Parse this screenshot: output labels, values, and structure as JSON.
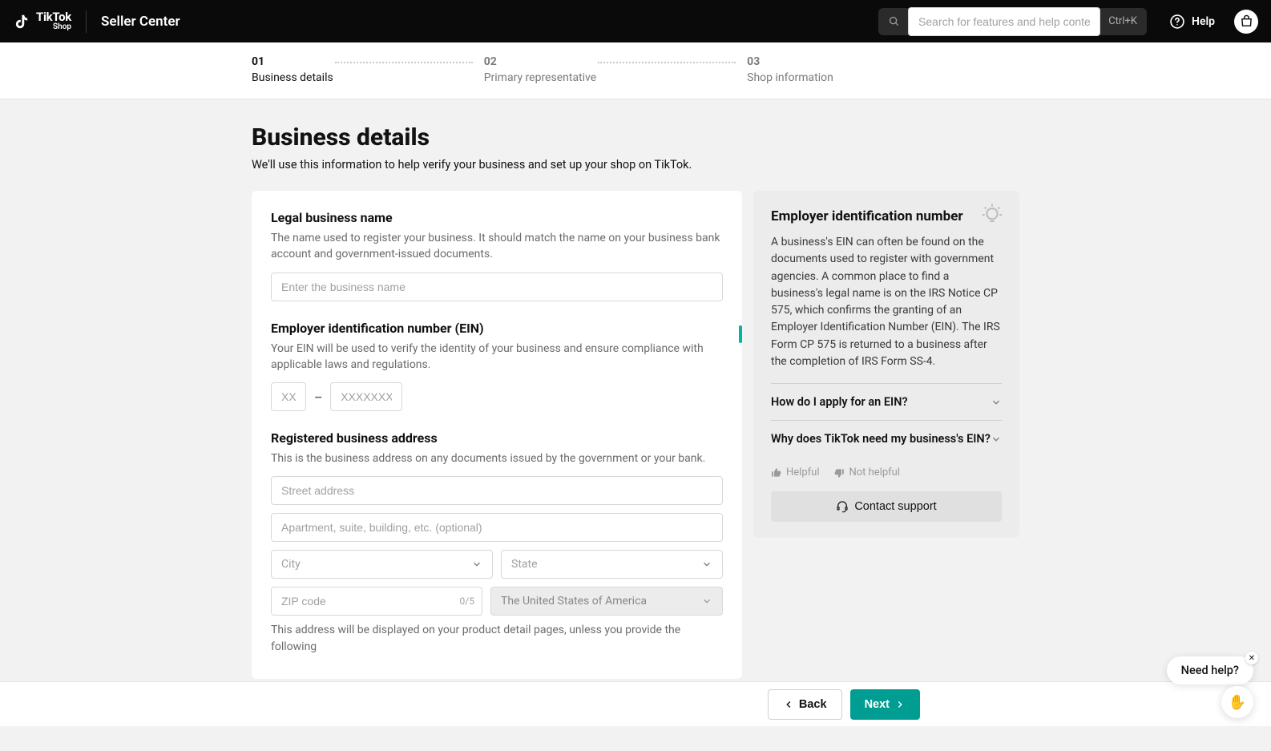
{
  "header": {
    "brand_top": "TikTok",
    "brand_bottom": "Shop",
    "seller_center": "Seller Center",
    "search_placeholder": "Search for features and help content",
    "kbd": "Ctrl+K",
    "help": "Help"
  },
  "stepper": {
    "steps": [
      {
        "num": "01",
        "label": "Business details"
      },
      {
        "num": "02",
        "label": "Primary representative"
      },
      {
        "num": "03",
        "label": "Shop information"
      }
    ]
  },
  "page": {
    "title": "Business details",
    "subtitle": "We'll use this information to help verify your business and set up your shop on TikTok."
  },
  "form": {
    "legal_name": {
      "title": "Legal business name",
      "help": "The name used to register your business. It should match the name on your business bank account and government-issued documents.",
      "placeholder": "Enter the business name"
    },
    "ein": {
      "title": "Employer identification number (EIN)",
      "help": "Your EIN will be used to verify the identity of your business and ensure compliance with applicable laws and regulations.",
      "ph1": "XX",
      "ph2": "XXXXXXX",
      "dash": "–"
    },
    "address": {
      "title": "Registered business address",
      "help": "This is the business address on any documents issued by the government or your bank.",
      "street_ph": "Street address",
      "apt_ph": "Apartment, suite, building, etc. (optional)",
      "city_ph": "City",
      "state_ph": "State",
      "zip_ph": "ZIP code",
      "zip_counter": "0/5",
      "country": "The United States of America",
      "note": "This address will be displayed on your product detail pages, unless you provide the following"
    }
  },
  "aside": {
    "title": "Employer identification number",
    "body": "A business's EIN can often be found on the documents used to register with government agencies. A common place to find a business's legal name is on the IRS Notice CP 575, which confirms the granting of an Employer Identification Number (EIN). The IRS Form CP 575 is returned to a business after the completion of IRS Form SS-4.",
    "faq1": "How do I apply for an EIN?",
    "faq2": "Why does TikTok need my business's EIN?",
    "helpful": "Helpful",
    "not_helpful": "Not helpful",
    "contact": "Contact support"
  },
  "footer": {
    "back": "Back",
    "next": "Next"
  },
  "floating": {
    "need_help": "Need help?"
  }
}
